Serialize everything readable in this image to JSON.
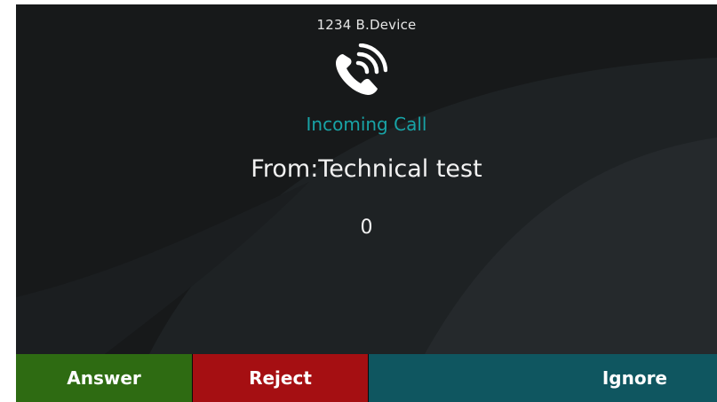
{
  "header": {
    "title": "1234 B.Device"
  },
  "call": {
    "icon": "incoming-call-icon",
    "status": "Incoming Call",
    "from": "From:Technical test",
    "counter": "0"
  },
  "softkeys": {
    "answer": "Answer",
    "reject": "Reject",
    "ignore": "Ignore"
  },
  "colors": {
    "screen_bg": "#17191a",
    "status_text": "#18a3a6",
    "answer_bg": "#2e6b12",
    "reject_bg": "#a50f12",
    "ignore_bg": "#0f5660"
  }
}
